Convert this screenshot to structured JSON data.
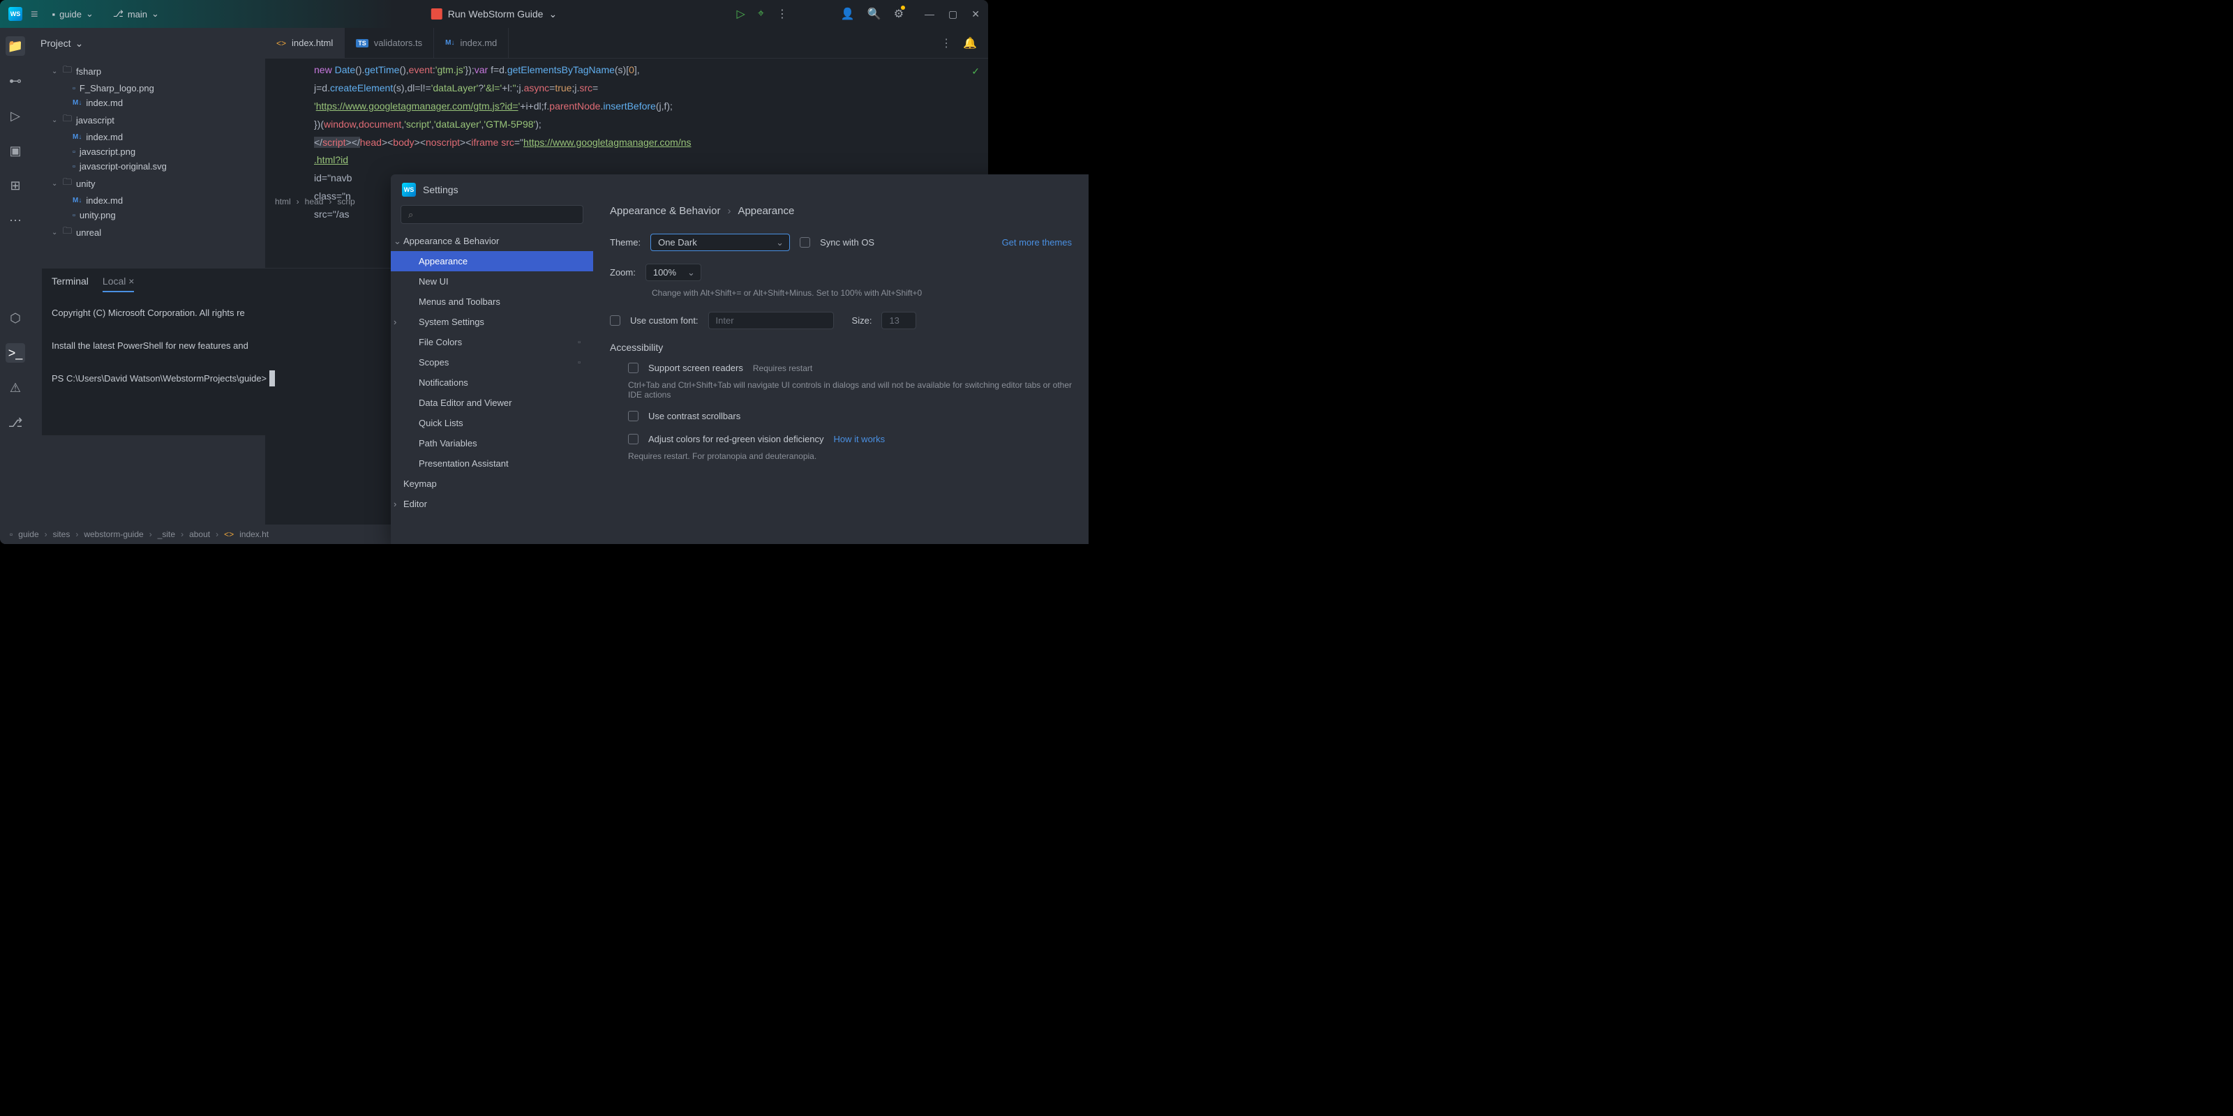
{
  "titlebar": {
    "project": "guide",
    "branch": "main",
    "runConfig": "Run WebStorm Guide"
  },
  "projectPanel": {
    "title": "Project"
  },
  "tree": {
    "folders": [
      "fsharp",
      "javascript",
      "unity",
      "unreal"
    ],
    "files": {
      "fsharp1": "F_Sharp_logo.png",
      "fsharp2": "index.md",
      "js1": "index.md",
      "js2": "javascript.png",
      "js3": "javascript-original.svg",
      "unity1": "index.md",
      "unity2": "unity.png"
    }
  },
  "tabs": {
    "t1": "index.html",
    "t2": "validators.ts",
    "t3": "index.md"
  },
  "code": {
    "l1a": "new ",
    "l1b": "Date",
    "l1c": "().",
    "l1d": "getTime",
    "l1e": "(),",
    "l1f": "event",
    "l1g": ":",
    "l1h": "'gtm.js'",
    "l1i": "});",
    "l1j": "var ",
    "l1k": "f=d.",
    "l1l": "getElementsByTagName",
    "l1m": "(s)[",
    "l1n": "0",
    "l1o": "],",
    "l2a": "j=d.",
    "l2b": "createElement",
    "l2c": "(s),dl=l!=",
    "l2d": "'dataLayer'",
    "l2e": "?",
    "l2f": "'&l='",
    "l2g": "+l:",
    "l2h": "''",
    "l2i": ";j.",
    "l2j": "async",
    "l2k": "=",
    "l2l": "true",
    "l2m": ";j.",
    "l2n": "src",
    "l2o": "=",
    "l3a": "'",
    "l3b": "https://www.googletagmanager.com/gtm.js?id=",
    "l3c": "'",
    "l3d": "+i+dl;f.",
    "l3e": "parentNode",
    "l3f": ".",
    "l3g": "insertBefore",
    "l3h": "(j,f);",
    "l4a": "})(",
    "l4b": "window",
    "l4c": ",",
    "l4d": "document",
    "l4e": ",",
    "l4f": "'script'",
    "l4g": ",",
    "l4h": "'dataLayer'",
    "l4i": ",",
    "l4j": "'GTM-5P98'",
    "l4k": ");",
    "l5a": "</",
    "l5b": "script",
    "l5c": "></",
    "l5d": "head",
    "l5e": "><",
    "l5f": "body",
    "l5g": "><",
    "l5h": "noscript",
    "l5i": "><",
    "l5j": "iframe ",
    "l5k": "src",
    "l5l": "=\"",
    "l5m": "https://www.googletagmanager.com/ns",
    "l6a": ".html?id",
    "l7a": "id=\"navb",
    "l8a": "class=\"n",
    "l9a": "src=\"/as"
  },
  "editorBreadcrumb": {
    "b1": "html",
    "b2": "head",
    "b3": "scrip"
  },
  "terminal": {
    "tab1": "Terminal",
    "tab2": "Local",
    "line1": "Copyright (C) Microsoft Corporation. All rights re",
    "line2": "Install the latest PowerShell for new features and",
    "line3": "PS C:\\Users\\David Watson\\WebstormProjects\\guide> "
  },
  "statusBar": {
    "s1": "guide",
    "s2": "sites",
    "s3": "webstorm-guide",
    "s4": "_site",
    "s5": "about",
    "s6": "index.ht"
  },
  "settings": {
    "title": "Settings",
    "searchPlaceholder": "",
    "nav": {
      "appearance_behavior": "Appearance & Behavior",
      "appearance": "Appearance",
      "new_ui": "New UI",
      "menus": "Menus and Toolbars",
      "system": "System Settings",
      "file_colors": "File Colors",
      "scopes": "Scopes",
      "notifications": "Notifications",
      "data_editor": "Data Editor and Viewer",
      "quick_lists": "Quick Lists",
      "path_vars": "Path Variables",
      "presentation": "Presentation Assistant",
      "keymap": "Keymap",
      "editor": "Editor"
    },
    "breadcrumb": {
      "a": "Appearance & Behavior",
      "b": "Appearance"
    },
    "theme": {
      "label": "Theme:",
      "value": "One Dark",
      "sync": "Sync with OS",
      "more": "Get more themes"
    },
    "zoom": {
      "label": "Zoom:",
      "value": "100%",
      "hint": "Change with Alt+Shift+= or Alt+Shift+Minus. Set to 100% with Alt+Shift+0"
    },
    "font": {
      "label": "Use custom font:",
      "value": "Inter",
      "sizeLabel": "Size:",
      "sizeValue": "13"
    },
    "accessibility": {
      "title": "Accessibility",
      "screen": "Support screen readers",
      "restart": "Requires restart",
      "screenHint": "Ctrl+Tab and Ctrl+Shift+Tab will navigate UI controls in dialogs and will not be available for switching editor tabs or other IDE actions",
      "contrast": "Use contrast scrollbars",
      "colorblind": "Adjust colors for red-green vision deficiency",
      "howit": "How it works",
      "cbHint": "Requires restart. For protanopia and deuteranopia."
    }
  }
}
